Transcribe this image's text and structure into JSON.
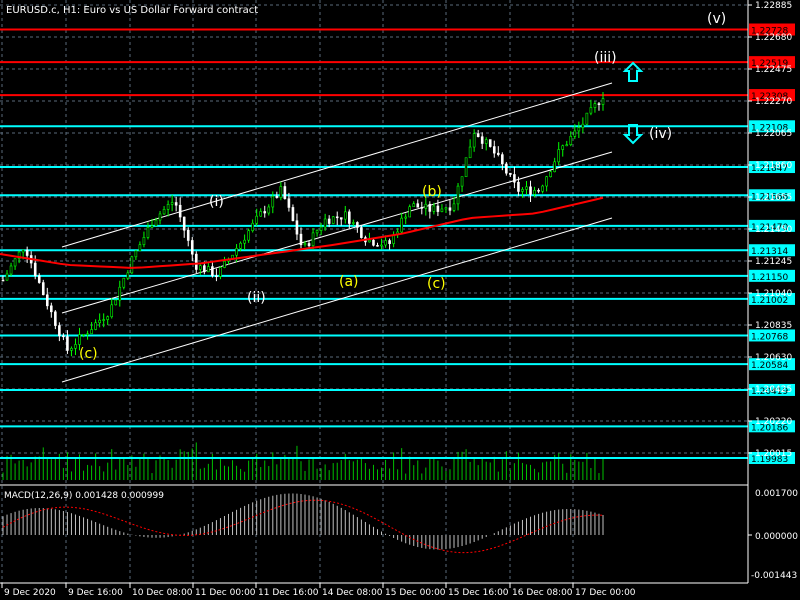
{
  "header": {
    "title": "EURUSD.c, H1:  Euro vs US Dollar Forward contract"
  },
  "macd_label": "MACD(12,26,9) 0.001428 0.000999",
  "chart_data": {
    "type": "line",
    "title": "EURUSD.c, H1",
    "price_axis": {
      "range": [
        1.1987,
        1.2295
      ],
      "ticks": [
        "1.22885",
        "1.22680",
        "1.22475",
        "1.22270",
        "1.22065",
        "1.21860",
        "1.21655",
        "1.21450",
        "1.21245",
        "1.21040",
        "1.20835",
        "1.20630",
        "1.20425",
        "1.20220",
        "1.20015"
      ]
    },
    "time_ticks": [
      "9 Dec 2020",
      "9 Dec 16:00",
      "10 Dec 08:00",
      "11 Dec 00:00",
      "11 Dec 16:00",
      "14 Dec 08:00",
      "15 Dec 00:00",
      "15 Dec 16:00",
      "16 Dec 08:00",
      "17 Dec 00:00"
    ],
    "price_path": [
      1.21123,
      1.21348,
      1.20995,
      1.20675,
      1.20803,
      1.20931,
      1.21251,
      1.21508,
      1.21636,
      1.21219,
      1.21155,
      1.21348,
      1.2154,
      1.217,
      1.21316,
      1.21508,
      1.2154,
      1.2138,
      1.21348,
      1.21604,
      1.21572,
      1.21604,
      1.22084,
      1.21924,
      1.217,
      1.217,
      1.21956,
      1.22116,
      1.22308
    ],
    "moving_average": [
      1.2129,
      1.2122,
      1.212,
      1.2123,
      1.2129,
      1.2135,
      1.2142,
      1.2152,
      1.2155,
      1.2165
    ],
    "levels": [
      {
        "price": "1.22728",
        "color": "#ff0000"
      },
      {
        "price": "1.22519",
        "color": "#ff0000"
      },
      {
        "price": "1.22308",
        "color": "#ff0000"
      },
      {
        "price": "1.22108",
        "color": "#00ffff"
      },
      {
        "price": "1.21847",
        "color": "#00ffff"
      },
      {
        "price": "1.21666",
        "color": "#00ffff"
      },
      {
        "price": "1.21470",
        "color": "#00ffff"
      },
      {
        "price": "1.21314",
        "color": "#00ffff"
      },
      {
        "price": "1.21150",
        "color": "#00ffff"
      },
      {
        "price": "1.21002",
        "color": "#00ffff"
      },
      {
        "price": "1.20768",
        "color": "#00ffff"
      },
      {
        "price": "1.20584",
        "color": "#00ffff"
      },
      {
        "price": "1.20419",
        "color": "#00ffff"
      },
      {
        "price": "1.20186",
        "color": "#00ffff"
      },
      {
        "price": "1.19983",
        "color": "#00ffff"
      }
    ],
    "wave_labels": [
      "(v)",
      "(iii)",
      "(iv)",
      "(i)",
      "(ii)",
      "(a)",
      "(b)",
      "(c)",
      "(c)"
    ],
    "macd_axis": {
      "ticks": [
        "0.001700",
        "0.000000",
        "-0.001443"
      ]
    }
  },
  "colors": {
    "bull": "#00ff00",
    "bear": "#ffffff",
    "ma": "#ff0000",
    "grid": "#5a6a7a",
    "level_red": "#ff0000",
    "level_cyan": "#00ffff"
  }
}
